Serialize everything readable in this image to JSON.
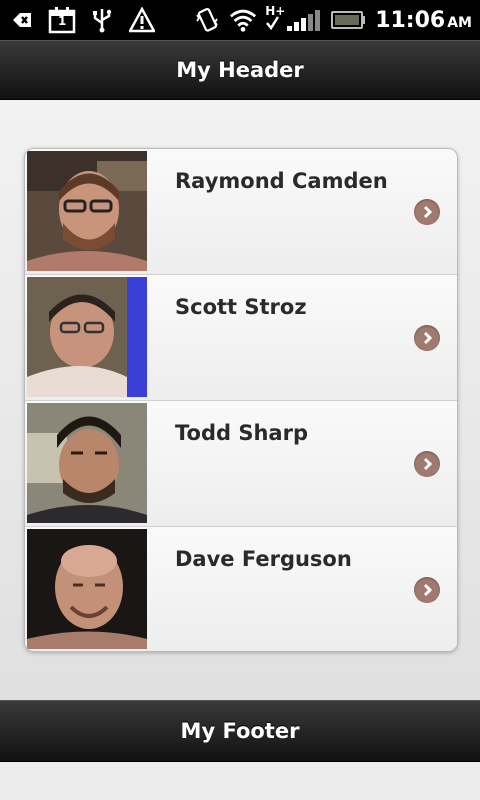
{
  "status_bar": {
    "time": "11:06",
    "ampm": "AM",
    "icons": [
      "back-arrow-icon",
      "calendar-icon",
      "usb-icon",
      "warning-icon",
      "vibrate-icon",
      "wifi-icon",
      "hplus-signal-icon",
      "battery-icon"
    ],
    "calendar_day": "1",
    "network_label": "H+"
  },
  "header": {
    "title": "My Header"
  },
  "footer": {
    "title": "My Footer"
  },
  "list": {
    "items": [
      {
        "name": "Raymond Camden",
        "avatar": "raymond-photo"
      },
      {
        "name": "Scott Stroz",
        "avatar": "scott-photo"
      },
      {
        "name": "Todd Sharp",
        "avatar": "todd-photo"
      },
      {
        "name": "Dave Ferguson",
        "avatar": "dave-photo"
      }
    ]
  },
  "colors": {
    "bar_dark": "#111111",
    "arrow_bg": "#a07a6e",
    "text_dark": "#2a2a2a"
  }
}
